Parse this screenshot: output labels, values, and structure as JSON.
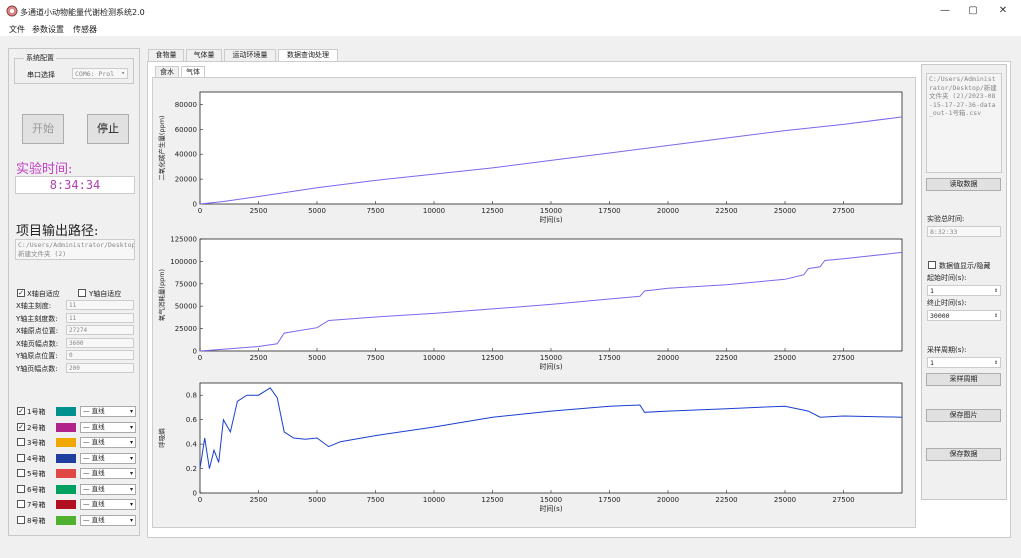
{
  "window": {
    "title": "多通道小动物能量代谢检测系统2.0",
    "minimize": "—",
    "maximize": "▢",
    "close": "✕"
  },
  "menu": [
    "文件",
    "参数设置",
    "传感器"
  ],
  "left": {
    "config_title": "系统配置",
    "port_label": "串口选择",
    "port_value": "COM6: Prol",
    "start_label": "开始",
    "stop_label": "停止",
    "exp_time_label": "实验时间:",
    "exp_time_value": "8:34:34",
    "output_label": "项目输出路径:",
    "output_path": "C:/Users/Administrator/Desktop/新建文件夹 (2)",
    "x_auto": "X轴自适应",
    "y_auto": "Y轴自适应",
    "axis_params": [
      {
        "label": "X轴主刻度:",
        "value": "11"
      },
      {
        "label": "Y轴主刻度数:",
        "value": "11"
      },
      {
        "label": "X轴原点位置:",
        "value": "27274"
      },
      {
        "label": "X轴页幅点数:",
        "value": "3600"
      },
      {
        "label": "Y轴原点位置:",
        "value": "0"
      },
      {
        "label": "Y轴页幅点数:",
        "value": "200"
      }
    ],
    "channels": [
      {
        "label": "1号箱",
        "checked": true,
        "color": "#00918e",
        "line": "直线"
      },
      {
        "label": "2号箱",
        "checked": true,
        "color": "#b0238a",
        "line": "直线"
      },
      {
        "label": "3号箱",
        "checked": false,
        "color": "#f0a800",
        "line": "直线"
      },
      {
        "label": "4号箱",
        "checked": false,
        "color": "#1f3fa0",
        "line": "直线"
      },
      {
        "label": "5号箱",
        "checked": false,
        "color": "#e04848",
        "line": "直线"
      },
      {
        "label": "6号箱",
        "checked": false,
        "color": "#00a060",
        "line": "直线"
      },
      {
        "label": "7号箱",
        "checked": false,
        "color": "#b01020",
        "line": "直线"
      },
      {
        "label": "8号箱",
        "checked": false,
        "color": "#50b030",
        "line": "直线"
      }
    ]
  },
  "tabs": [
    "食物量",
    "气体量",
    "运动环境量",
    "数据查询处理"
  ],
  "subtabs": [
    "食水",
    "气体"
  ],
  "right": {
    "file_path": "C:/Users/Administrator/Desktop/新建文件夹 (2)/2023-08-15-17-27-36-data_out-1号箱.csv",
    "read_button": "读取数据",
    "total_time_label": "实验总时间:",
    "total_time_value": "8:32:33",
    "display_toggle": "数据值显示/隐藏",
    "start_time_label": "起始时间(s):",
    "start_time_value": "1",
    "end_time_label": "终止时间(s):",
    "end_time_value": "30000",
    "period_label": "采样周期(s):",
    "period_value": "1",
    "period_button": "采样周期",
    "save_image_button": "保存图片",
    "save_data_button": "保存数据"
  },
  "chart_data": [
    {
      "type": "line",
      "ylabel": "二氧化碳产生量(ppm)",
      "xlabel": "时间(s)",
      "xlim": [
        0,
        30000
      ],
      "ylim": [
        0,
        90000
      ],
      "yticks": [
        0,
        20000,
        40000,
        60000,
        80000
      ],
      "xticks": [
        0,
        2500,
        5000,
        7500,
        10000,
        12500,
        15000,
        17500,
        20000,
        22500,
        25000,
        27500
      ],
      "color": "#7b68ee",
      "x": [
        0,
        1000,
        2500,
        5000,
        7500,
        10000,
        12500,
        15000,
        17500,
        20000,
        22500,
        25000,
        27500,
        30000
      ],
      "y": [
        0,
        2000,
        6000,
        13000,
        19000,
        24000,
        29000,
        35000,
        41000,
        47000,
        53000,
        59000,
        64000,
        70000
      ]
    },
    {
      "type": "line",
      "ylabel": "氧气消耗量(ppm)",
      "xlabel": "时间(s)",
      "xlim": [
        0,
        30000
      ],
      "ylim": [
        0,
        125000
      ],
      "yticks": [
        0,
        25000,
        50000,
        75000,
        100000,
        125000
      ],
      "xticks": [
        0,
        2500,
        5000,
        7500,
        10000,
        12500,
        15000,
        17500,
        20000,
        22500,
        25000,
        27500
      ],
      "color": "#7b68ee",
      "x": [
        0,
        1000,
        2500,
        3300,
        3600,
        5000,
        5500,
        7500,
        10000,
        12500,
        15000,
        17500,
        18800,
        19000,
        20000,
        22500,
        25000,
        25800,
        26000,
        26500,
        26700,
        27500,
        30000
      ],
      "y": [
        0,
        2000,
        5000,
        8000,
        20000,
        26000,
        34000,
        38000,
        42000,
        47000,
        52000,
        58000,
        61000,
        67000,
        70000,
        74000,
        80000,
        85000,
        92000,
        94000,
        101000,
        103000,
        110000
      ]
    },
    {
      "type": "line",
      "ylabel": "呼吸熵",
      "xlabel": "时间(s)",
      "xlim": [
        0,
        30000
      ],
      "ylim": [
        0,
        0.9
      ],
      "yticks": [
        0,
        0.2,
        0.4,
        0.6,
        0.8
      ],
      "xticks": [
        0,
        2500,
        5000,
        7500,
        10000,
        12500,
        15000,
        17500,
        20000,
        22500,
        25000,
        27500
      ],
      "color": "#1a3fd0",
      "x": [
        0,
        200,
        400,
        600,
        800,
        1000,
        1300,
        1600,
        2000,
        2500,
        3000,
        3300,
        3600,
        4000,
        4500,
        5000,
        5500,
        6000,
        7500,
        10000,
        12500,
        15000,
        17500,
        18800,
        19000,
        20000,
        22500,
        25000,
        26000,
        26500,
        27500,
        30000
      ],
      "y": [
        0.2,
        0.45,
        0.2,
        0.35,
        0.25,
        0.6,
        0.5,
        0.75,
        0.8,
        0.8,
        0.86,
        0.78,
        0.5,
        0.45,
        0.44,
        0.45,
        0.38,
        0.42,
        0.47,
        0.54,
        0.62,
        0.67,
        0.71,
        0.72,
        0.66,
        0.67,
        0.69,
        0.71,
        0.67,
        0.62,
        0.63,
        0.62
      ]
    }
  ]
}
